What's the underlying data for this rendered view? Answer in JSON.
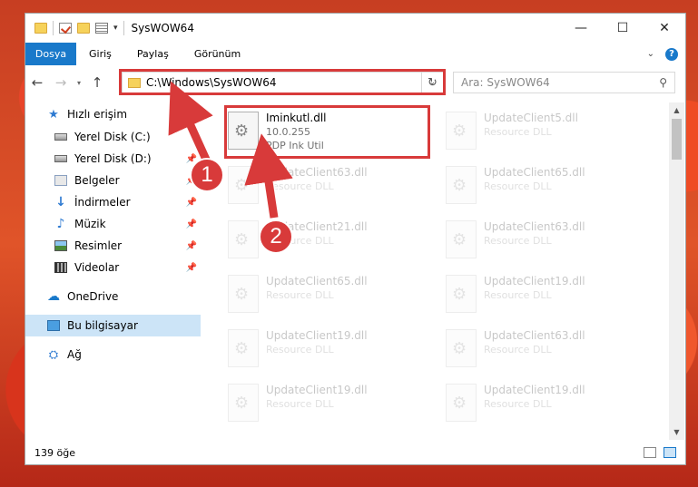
{
  "window": {
    "title": "SysWOW64"
  },
  "controls": {
    "minimize": "—",
    "maximize": "☐",
    "close": "✕"
  },
  "ribbon": {
    "file_tab": "Dosya",
    "tabs": [
      "Giriş",
      "Paylaş",
      "Görünüm"
    ]
  },
  "navbar": {
    "address": "C:\\Windows\\SysWOW64",
    "search_placeholder": "Ara: SysWOW64"
  },
  "sidebar": {
    "items": [
      {
        "label": "Hızlı erişim",
        "icon": "star-icon"
      },
      {
        "label": "Yerel Disk (C:)",
        "icon": "drive-icon"
      },
      {
        "label": "Yerel Disk (D:)",
        "icon": "drive-icon"
      },
      {
        "label": "Belgeler",
        "icon": "documents-icon"
      },
      {
        "label": "İndirmeler",
        "icon": "downloads-icon"
      },
      {
        "label": "Müzik",
        "icon": "music-icon"
      },
      {
        "label": "Resimler",
        "icon": "pictures-icon"
      },
      {
        "label": "Videolar",
        "icon": "videos-icon"
      },
      {
        "label": "OneDrive",
        "icon": "cloud-icon"
      },
      {
        "label": "Bu bilgisayar",
        "icon": "computer-icon"
      },
      {
        "label": "Ağ",
        "icon": "network-icon"
      }
    ]
  },
  "files": [
    {
      "name": "Iminkutl.dll",
      "line2": "10.0.255",
      "line3": "PDP Ink Util"
    },
    {
      "name": "UpdateClient5.dll",
      "line2": "Resource DLL"
    },
    {
      "name": "UpdateClient63.dll",
      "line2": "Resource DLL"
    },
    {
      "name": "UpdateClient65.dll",
      "line2": "Resource DLL"
    },
    {
      "name": "UpdateClient21.dll",
      "line2": "Resource DLL"
    },
    {
      "name": "UpdateClient63.dll",
      "line2": "Resource DLL"
    },
    {
      "name": "UpdateClient65.dll",
      "line2": "Resource DLL"
    },
    {
      "name": "UpdateClient19.dll",
      "line2": "Resource DLL"
    },
    {
      "name": "UpdateClient19.dll",
      "line2": "Resource DLL"
    },
    {
      "name": "UpdateClient63.dll",
      "line2": "Resource DLL"
    },
    {
      "name": "UpdateClient19.dll",
      "line2": "Resource DLL"
    },
    {
      "name": "UpdateClient19.dll",
      "line2": "Resource DLL"
    }
  ],
  "status": {
    "item_count": "139 öğe"
  },
  "callouts": [
    "1",
    "2"
  ],
  "colors": {
    "accent": "#1979ca",
    "highlight_red": "#d83a3a",
    "selection": "#cce4f7"
  }
}
